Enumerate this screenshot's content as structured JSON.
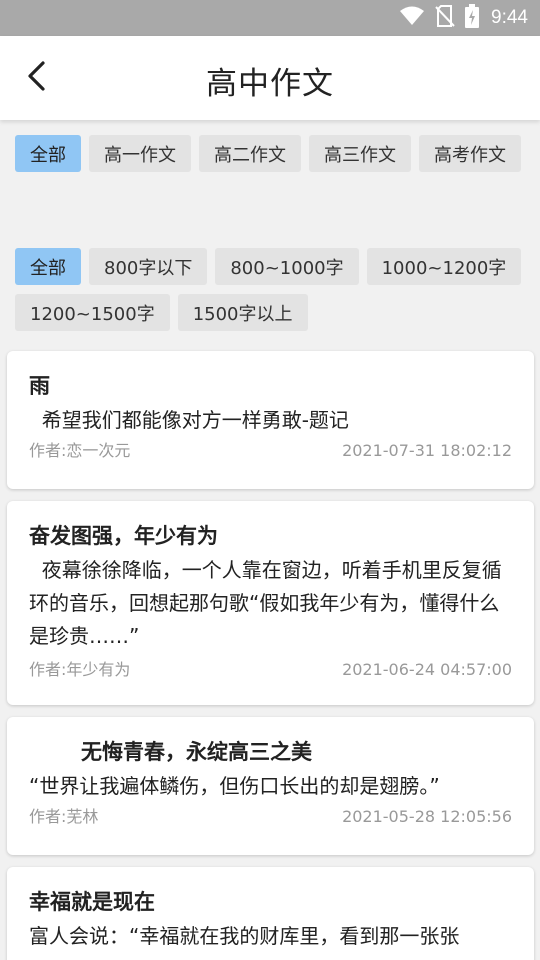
{
  "status_bar": {
    "time": "9:44",
    "icons": [
      "wifi-icon",
      "no-sim-icon",
      "battery-charging-icon"
    ]
  },
  "header": {
    "title": "高中作文",
    "back_icon": "chevron-left-icon"
  },
  "grade_filter": {
    "selected_index": 0,
    "options": [
      "全部",
      "高一作文",
      "高二作文",
      "高三作文",
      "高考作文"
    ]
  },
  "length_filter": {
    "selected_index": 0,
    "options": [
      "全部",
      "800字以下",
      "800~1000字",
      "1000~1200字",
      "1200~1500字",
      "1500字以上"
    ]
  },
  "articles": [
    {
      "title": "雨",
      "excerpt": "  希望我们都能像对方一样勇敢-题记",
      "author": "作者:恋一次元",
      "date": "2021-07-31 18:02:12"
    },
    {
      "title": "奋发图强，年少有为",
      "excerpt": "  夜幕徐徐降临，一个人靠在窗边，听着手机里反复循环的音乐，回想起那句歌“假如我年少有为，懂得什么是珍贵……”",
      "author": "作者:年少有为",
      "date": "2021-06-24 04:57:00"
    },
    {
      "title": "无悔青春，永绽高三之美",
      "excerpt": "“世界让我遍体鳞伤，但伤口长出的却是翅膀。”",
      "author": "作者:芜林",
      "date": "2021-05-28 12:05:56"
    },
    {
      "title": "幸福就是现在",
      "excerpt": "富人会说：“幸福就在我的财库里，看到那一张张",
      "author": "",
      "date": ""
    }
  ],
  "colors": {
    "status_bar": "#a9a9a9",
    "chip_selected": "#90c6f4",
    "chip": "#e3e3e3",
    "meta_text": "#999999"
  }
}
